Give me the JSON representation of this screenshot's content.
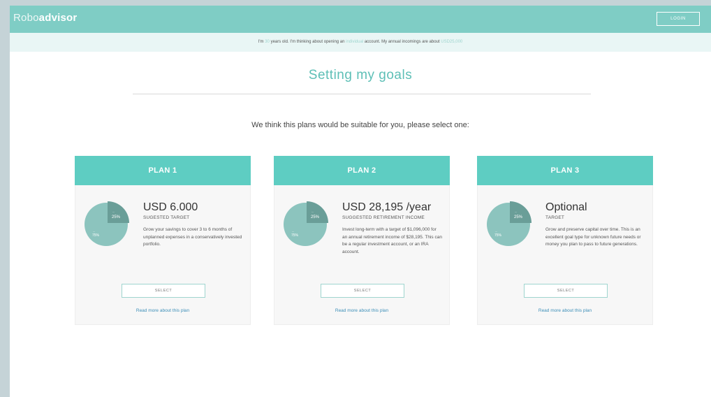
{
  "header": {
    "logo_light": "Robo",
    "logo_bold": "advisor",
    "login_label": "LOGIN"
  },
  "intro": {
    "t1": "I'm ",
    "age": "30",
    "t2": " years old. I'm thinking about opening an ",
    "account_type": "individual",
    "t3": " account. My annual incomings are about ",
    "income": "USD25,000"
  },
  "page": {
    "title": "Setting my goals",
    "prompt": "We think this plans would be suitable for you, please select one:"
  },
  "plans": [
    {
      "name": "PLAN 1",
      "amount": "USD 6.000",
      "subtitle": "SUGESTED TARGET",
      "description": "Grow your savings to cover 3 to 6 months of unplanned expenses in a conservatively invested portfolio.",
      "select_label": "SELECT",
      "read_more": "Read more about this plan",
      "allocation": {
        "slice1": {
          "label_small": "—",
          "percent": "25%",
          "fraction": 0.25
        },
        "slice2": {
          "label_small": "—",
          "percent": "75%",
          "fraction": 0.75
        }
      }
    },
    {
      "name": "PLAN 2",
      "amount": "USD 28,195 /year",
      "subtitle": "SUGGESTED RETIREMENT INCOME",
      "description": "Invest long-term with a target of $1,096,000 for an annual retirement income of $28,195. This can be a regular investment account, or an IRA account.",
      "select_label": "SELECT",
      "read_more": "Read more about this plan",
      "allocation": {
        "slice1": {
          "label_small": "—",
          "percent": "25%",
          "fraction": 0.25
        },
        "slice2": {
          "label_small": "—",
          "percent": "75%",
          "fraction": 0.75
        }
      }
    },
    {
      "name": "PLAN 3",
      "amount": "Optional",
      "subtitle": "TARGET",
      "description": "Grow and preserve capital over time. This is an excellent goal type for unknown future needs or money you plan to pass to future generations.",
      "select_label": "SELECT",
      "read_more": "Read more about this plan",
      "allocation": {
        "slice1": {
          "label_small": "—",
          "percent": "25%",
          "fraction": 0.25
        },
        "slice2": {
          "label_small": "—",
          "percent": "75%",
          "fraction": 0.75
        }
      }
    }
  ],
  "colors": {
    "accent": "#5ecdc2",
    "header": "#7fcdc5",
    "pie_large": "#8cc4be",
    "pie_small": "#6a9e98",
    "link": "#3d8fb8"
  }
}
